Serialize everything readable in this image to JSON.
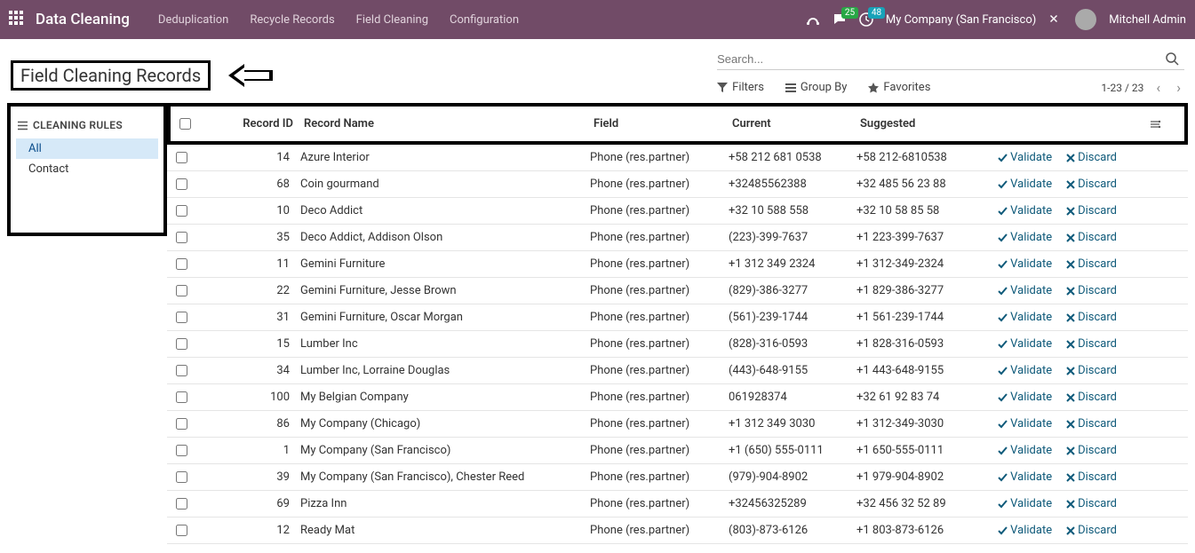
{
  "topbar": {
    "brand": "Data Cleaning",
    "nav": [
      "Deduplication",
      "Recycle Records",
      "Field Cleaning",
      "Configuration"
    ],
    "msg_count": "25",
    "clock_count": "48",
    "company": "My Company (San Francisco)",
    "user": "Mitchell Admin"
  },
  "breadcrumb": {
    "title": "Field Cleaning Records"
  },
  "search": {
    "placeholder": "Search...",
    "filters": "Filters",
    "group_by": "Group By",
    "favorites": "Favorites",
    "pager": "1-23 / 23"
  },
  "sidebar": {
    "header": "CLEANING RULES",
    "items": [
      {
        "label": "All",
        "active": true
      },
      {
        "label": "Contact",
        "active": false
      }
    ]
  },
  "table": {
    "headers": {
      "record_id": "Record ID",
      "record_name": "Record Name",
      "field": "Field",
      "current": "Current",
      "suggested": "Suggested"
    },
    "validate": "Validate",
    "discard": "Discard",
    "rows": [
      {
        "id": "14",
        "name": "Azure Interior",
        "field": "Phone (res.partner)",
        "current": "+58 212 681 0538",
        "suggested": "+58 212-6810538"
      },
      {
        "id": "68",
        "name": "Coin gourmand",
        "field": "Phone (res.partner)",
        "current": "+32485562388",
        "suggested": "+32 485 56 23 88"
      },
      {
        "id": "10",
        "name": "Deco Addict",
        "field": "Phone (res.partner)",
        "current": "+32 10 588 558",
        "suggested": "+32 10 58 85 58"
      },
      {
        "id": "35",
        "name": "Deco Addict, Addison Olson",
        "field": "Phone (res.partner)",
        "current": "(223)-399-7637",
        "suggested": "+1 223-399-7637"
      },
      {
        "id": "11",
        "name": "Gemini Furniture",
        "field": "Phone (res.partner)",
        "current": "+1 312 349 2324",
        "suggested": "+1 312-349-2324"
      },
      {
        "id": "22",
        "name": "Gemini Furniture, Jesse Brown",
        "field": "Phone (res.partner)",
        "current": "(829)-386-3277",
        "suggested": "+1 829-386-3277"
      },
      {
        "id": "31",
        "name": "Gemini Furniture, Oscar Morgan",
        "field": "Phone (res.partner)",
        "current": "(561)-239-1744",
        "suggested": "+1 561-239-1744"
      },
      {
        "id": "15",
        "name": "Lumber Inc",
        "field": "Phone (res.partner)",
        "current": "(828)-316-0593",
        "suggested": "+1 828-316-0593"
      },
      {
        "id": "34",
        "name": "Lumber Inc, Lorraine Douglas",
        "field": "Phone (res.partner)",
        "current": "(443)-648-9155",
        "suggested": "+1 443-648-9155"
      },
      {
        "id": "100",
        "name": "My Belgian Company",
        "field": "Phone (res.partner)",
        "current": "061928374",
        "suggested": "+32 61 92 83 74"
      },
      {
        "id": "86",
        "name": "My Company (Chicago)",
        "field": "Phone (res.partner)",
        "current": "+1 312 349 3030",
        "suggested": "+1 312-349-3030"
      },
      {
        "id": "1",
        "name": "My Company (San Francisco)",
        "field": "Phone (res.partner)",
        "current": "+1 (650) 555-0111",
        "suggested": "+1 650-555-0111"
      },
      {
        "id": "39",
        "name": "My Company (San Francisco), Chester Reed",
        "field": "Phone (res.partner)",
        "current": "(979)-904-8902",
        "suggested": "+1 979-904-8902"
      },
      {
        "id": "69",
        "name": "Pizza Inn",
        "field": "Phone (res.partner)",
        "current": "+32456325289",
        "suggested": "+32 456 32 52 89"
      },
      {
        "id": "12",
        "name": "Ready Mat",
        "field": "Phone (res.partner)",
        "current": "(803)-873-6126",
        "suggested": "+1 803-873-6126"
      }
    ]
  }
}
